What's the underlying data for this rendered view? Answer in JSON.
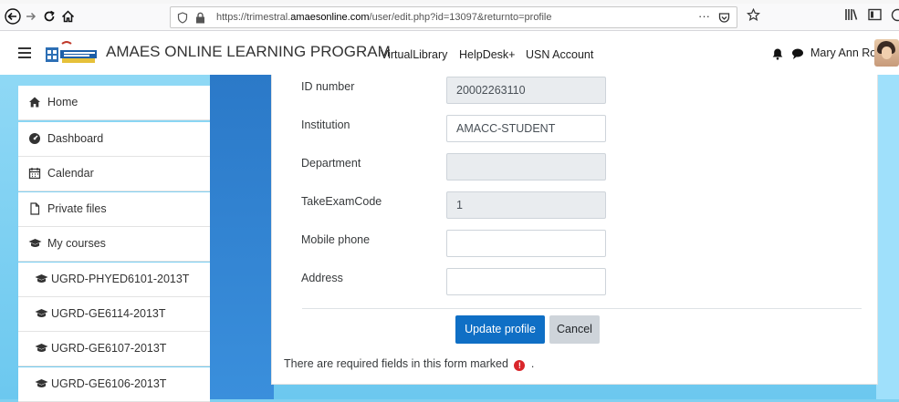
{
  "browser": {
    "url_prefix": "https://trimestral.",
    "url_domain": "amaesonline.com",
    "url_path": "/user/edit.php?id=13097&returnto=profile",
    "more_label": "···"
  },
  "navbar": {
    "brand": "AMAES ONLINE LEARNING PROGRAM",
    "links": [
      "VirtualLibrary",
      "HelpDesk+",
      "USN Account"
    ],
    "user_name": "Mary Ann Ronan"
  },
  "sidebar": {
    "items": [
      {
        "label": "Home",
        "icon": "home-icon"
      },
      {
        "label": "Dashboard",
        "icon": "dashboard-icon"
      },
      {
        "label": "Calendar",
        "icon": "calendar-icon"
      },
      {
        "label": "Private files",
        "icon": "file-icon"
      },
      {
        "label": "My courses",
        "icon": "graduation-cap-icon"
      },
      {
        "label": "UGRD-PHYED6101-2013T",
        "icon": "graduation-cap-icon"
      },
      {
        "label": "UGRD-GE6114-2013T",
        "icon": "graduation-cap-icon"
      },
      {
        "label": "UGRD-GE6107-2013T",
        "icon": "graduation-cap-icon"
      },
      {
        "label": "UGRD-GE6106-2013T",
        "icon": "graduation-cap-icon"
      }
    ]
  },
  "form": {
    "fields": [
      {
        "label": "ID number",
        "value": "20002263110",
        "readonly": true
      },
      {
        "label": "Institution",
        "value": "AMACC-STUDENT",
        "readonly": false
      },
      {
        "label": "Department",
        "value": "",
        "readonly": true
      },
      {
        "label": "TakeExamCode",
        "value": "1",
        "readonly": true
      },
      {
        "label": "Mobile phone",
        "value": "",
        "readonly": false
      },
      {
        "label": "Address",
        "value": "",
        "readonly": false
      }
    ],
    "submit_label": "Update profile",
    "cancel_label": "Cancel",
    "required_note": "There are required fields in this form marked",
    "required_note_end": ".",
    "required_icon": "!"
  },
  "colors": {
    "primary": "#0f6fc5",
    "required": "#d9262b"
  }
}
